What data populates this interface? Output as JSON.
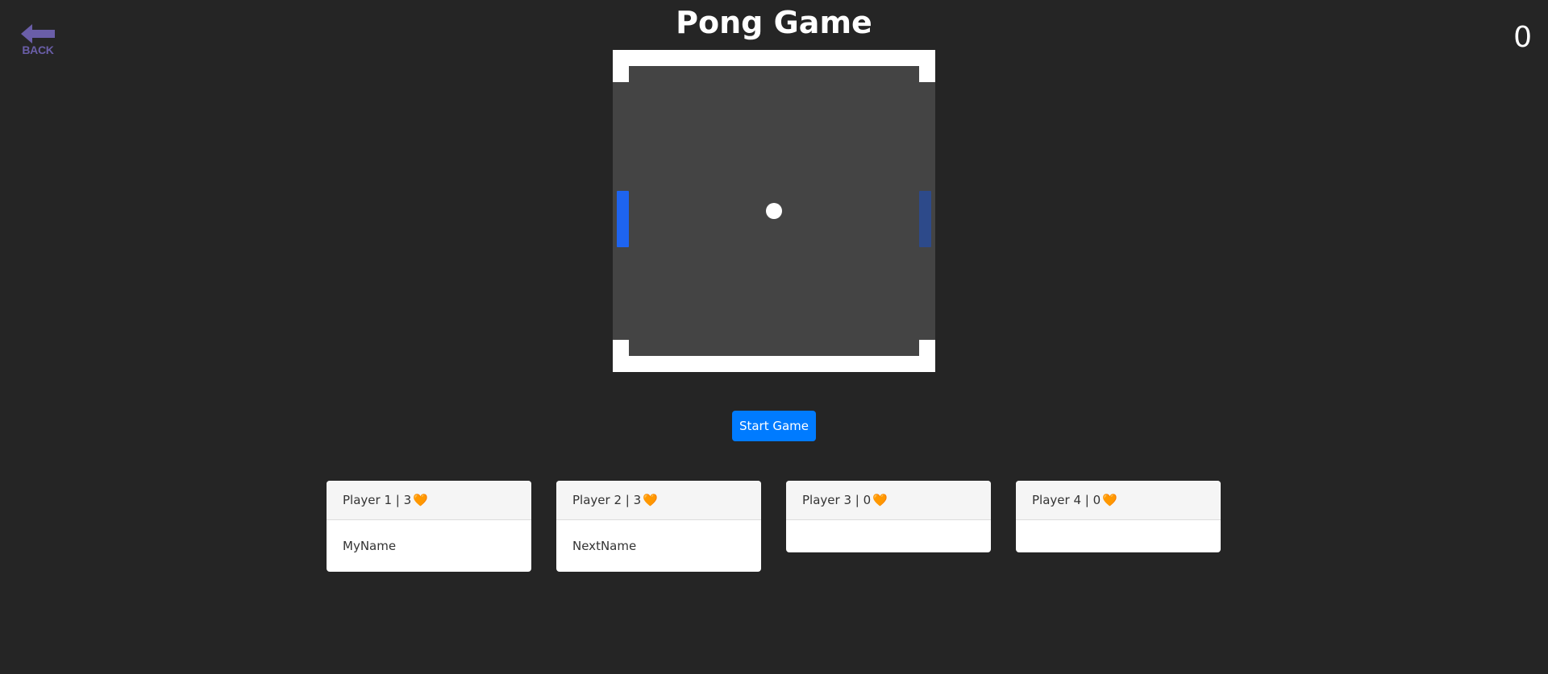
{
  "nav": {
    "back_label": "BACK"
  },
  "score": "0",
  "title": "Pong Game",
  "start_button_label": "Start Game",
  "colors": {
    "background": "#252525",
    "board": "#444444",
    "left_paddle": "#1e64f0",
    "right_paddle": "#2d4a8a",
    "heart": "#f0641e",
    "button": "#007bff",
    "back": "#6a5ea8"
  },
  "players": [
    {
      "label": "Player 1 | 3",
      "heart": "🧡",
      "name": "MyName"
    },
    {
      "label": "Player 2 | 3",
      "heart": "🧡",
      "name": "NextName"
    },
    {
      "label": "Player 3 | 0",
      "heart": "🧡",
      "name": ""
    },
    {
      "label": "Player 4 | 0",
      "heart": "🧡",
      "name": ""
    }
  ]
}
